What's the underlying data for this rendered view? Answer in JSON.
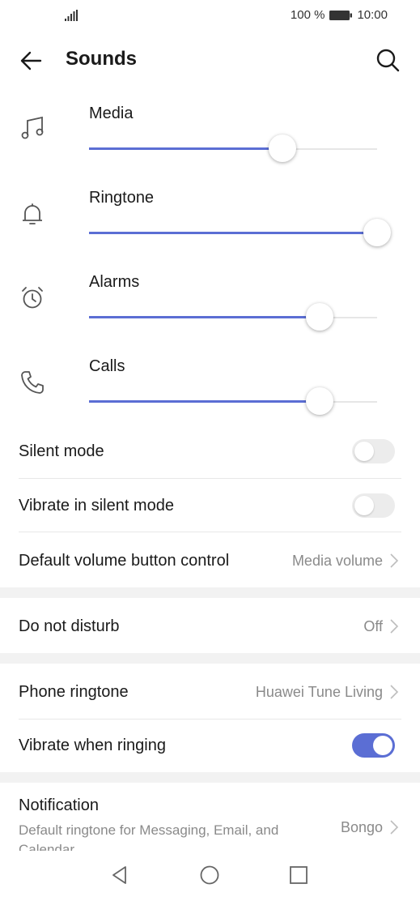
{
  "status_bar": {
    "battery_pct": "100 %",
    "time": "10:00"
  },
  "header": {
    "title": "Sounds"
  },
  "volumes": [
    {
      "label": "Media",
      "icon": "music-note-icon",
      "level": 0.67
    },
    {
      "label": "Ringtone",
      "icon": "bell-icon",
      "level": 1.0
    },
    {
      "label": "Alarms",
      "icon": "alarm-clock-icon",
      "level": 0.8
    },
    {
      "label": "Calls",
      "icon": "phone-icon",
      "level": 0.8
    }
  ],
  "settings": {
    "silent_mode": {
      "label": "Silent mode",
      "on": false
    },
    "vibrate_silent": {
      "label": "Vibrate in silent mode",
      "on": false
    },
    "default_volume_button": {
      "label": "Default volume button control",
      "value": "Media volume"
    },
    "do_not_disturb": {
      "label": "Do not disturb",
      "value": "Off"
    },
    "phone_ringtone": {
      "label": "Phone ringtone",
      "value": "Huawei Tune Living"
    },
    "vibrate_ringing": {
      "label": "Vibrate when ringing",
      "on": true
    },
    "notification": {
      "label": "Notification",
      "description": "Default ringtone for Messaging, Email, and Calendar",
      "value": "Bongo"
    }
  },
  "colors": {
    "accent": "#5b6ed4",
    "secondary_text": "#8a8a8a"
  }
}
